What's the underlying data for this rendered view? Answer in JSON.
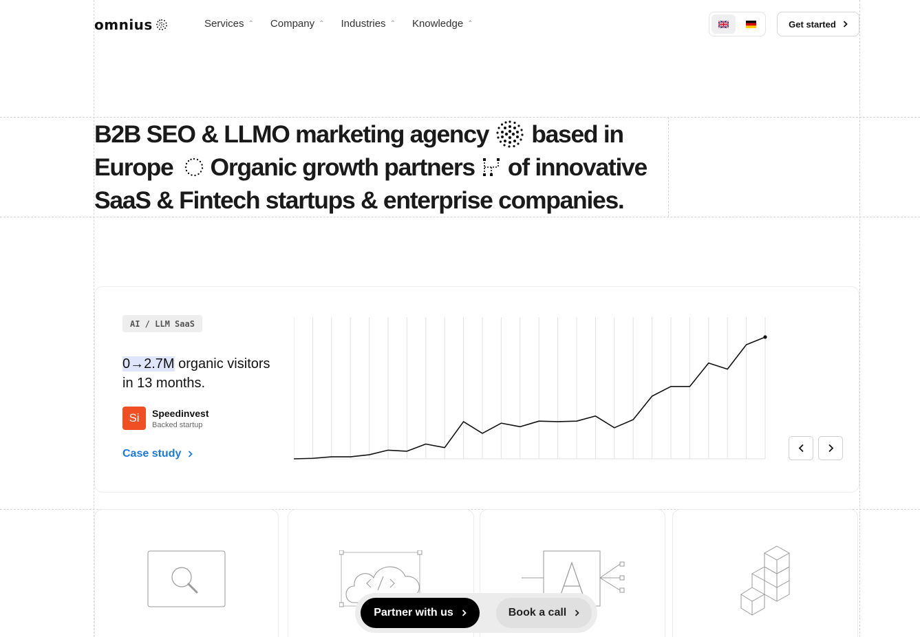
{
  "header": {
    "logo_text": "omnius",
    "nav": [
      {
        "label": "Services"
      },
      {
        "label": "Company"
      },
      {
        "label": "Industries"
      },
      {
        "label": "Knowledge"
      }
    ],
    "languages": [
      "uk-flag-icon",
      "germany-flag-icon"
    ],
    "get_started_label": "Get started"
  },
  "hero": {
    "line1_a": "B2B SEO & LLMO marketing agency",
    "line1_b": "based in",
    "line2_a": "Europe",
    "line2_b": "Organic growth partners",
    "line2_c": "of innovative",
    "line3": "SaaS & Fintech startups & enterprise companies."
  },
  "case": {
    "tag": "AI / LLM SaaS",
    "headline_highlight": "0→2.7M",
    "headline_rest": " organic visitors in 13 months.",
    "company_logo_text": "Si",
    "company_name": "Speedinvest",
    "company_sub": "Backed startup",
    "link_label": "Case study"
  },
  "chart_data": {
    "type": "line",
    "title": "",
    "xlabel": "",
    "ylabel": "",
    "x": [
      1,
      2,
      3,
      4,
      5,
      6,
      7,
      8,
      9,
      10,
      11,
      12,
      13,
      14,
      15,
      16,
      17,
      18,
      19,
      20,
      21,
      22,
      23,
      24,
      25,
      26
    ],
    "values": [
      0.0,
      0.01,
      0.04,
      0.04,
      0.08,
      0.17,
      0.15,
      0.29,
      0.22,
      0.73,
      0.5,
      0.7,
      0.63,
      0.74,
      0.73,
      0.74,
      0.84,
      0.61,
      0.77,
      1.23,
      1.42,
      1.42,
      1.88,
      1.76,
      2.24,
      2.39
    ],
    "ylim": [
      0,
      2.7
    ]
  },
  "cta": {
    "partner_label": "Partner with us",
    "book_label": "Book a call"
  },
  "colors": {
    "accent_blue": "#1a7ad9",
    "highlight": "#dfe6fb",
    "speedinvest": "#f04e23"
  }
}
